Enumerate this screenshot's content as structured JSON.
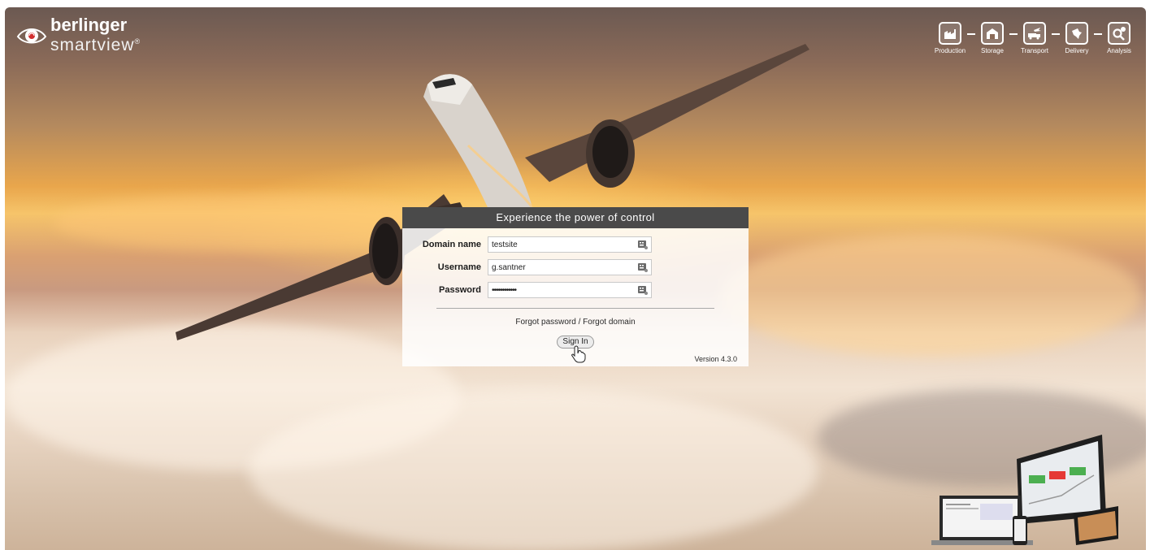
{
  "brand": {
    "name_line1": "berlinger",
    "name_line2": "smartview",
    "trademark": "®"
  },
  "process_nav": [
    {
      "label": "Production",
      "icon": "factory-icon"
    },
    {
      "label": "Storage",
      "icon": "warehouse-icon"
    },
    {
      "label": "Transport",
      "icon": "truck-plane-icon"
    },
    {
      "label": "Delivery",
      "icon": "delivery-hand-icon"
    },
    {
      "label": "Analysis",
      "icon": "magnifier-icon"
    }
  ],
  "login": {
    "title": "Experience the power of control",
    "fields": [
      {
        "label": "Domain name",
        "value": "testsite"
      },
      {
        "label": "Username",
        "value": "g.santner"
      },
      {
        "label": "Password",
        "value": "••••••••••••"
      }
    ],
    "forgot_link": "Forgot password / Forgot domain",
    "signin_label": "Sign In",
    "version": "Version 4.3.0"
  },
  "colors": {
    "header_bar": "#4a4a4a",
    "panel_bg": "#ffffff"
  }
}
